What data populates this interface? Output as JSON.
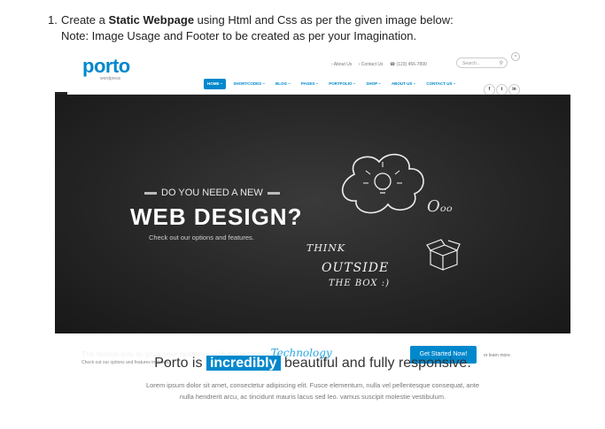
{
  "instructions": {
    "number": "1.",
    "line1_pre": "Create a ",
    "line1_bold": "Static Webpage",
    "line1_post": " using Html and Css as per the given image below:",
    "line2": "Note: Image Usage and Footer to be created as per your Imagination."
  },
  "site": {
    "logo": "porto",
    "logo_sub": "wordpress",
    "top_links": [
      "› About Us",
      "› Contact Us",
      "☎ (123) 456-7890"
    ],
    "search_placeholder": "Search...",
    "nav": [
      "HOME ~",
      "SHORTCODES ~",
      "BLOG ~",
      "PAGES ~",
      "PORTFOLIO ~",
      "SHOP ~",
      "ABOUT US ~",
      "CONTACT US ~"
    ],
    "social": [
      "f",
      "t",
      "in"
    ]
  },
  "hero": {
    "pre_heading": "DO YOU NEED A NEW",
    "heading": "WEB DESIGN?",
    "subheading": "Check out our options and features.",
    "chalk_think": "THINK",
    "chalk_outside": "OUTSIDE",
    "chalk_box": "THE BOX :)",
    "chalk_oo": "Oₒₒ",
    "strip_text": "The fastest way to grow your business with the leader in",
    "strip_tech": "Technology",
    "strip_sub": "Check out our options and features included.",
    "cta": "Get Started Now!",
    "learn_more": "or learn more."
  },
  "intro": {
    "pre": "Porto is",
    "highlight": "incredibly",
    "post": "beautiful and fully responsive.",
    "body_line1": "Lorem ipsum dolor sit amet, consectetur adipiscing elit. Fusce elementum, nulla vel pellentesque consequat, ante",
    "body_line2": "nulla hendrerit arcu, ac tincidunt mauris lacus sed leo. vamus suscipit molestie vestibulum."
  },
  "colors": {
    "accent": "#0088cc",
    "hero_bg": "#262626",
    "technology": "#29a8e0"
  }
}
